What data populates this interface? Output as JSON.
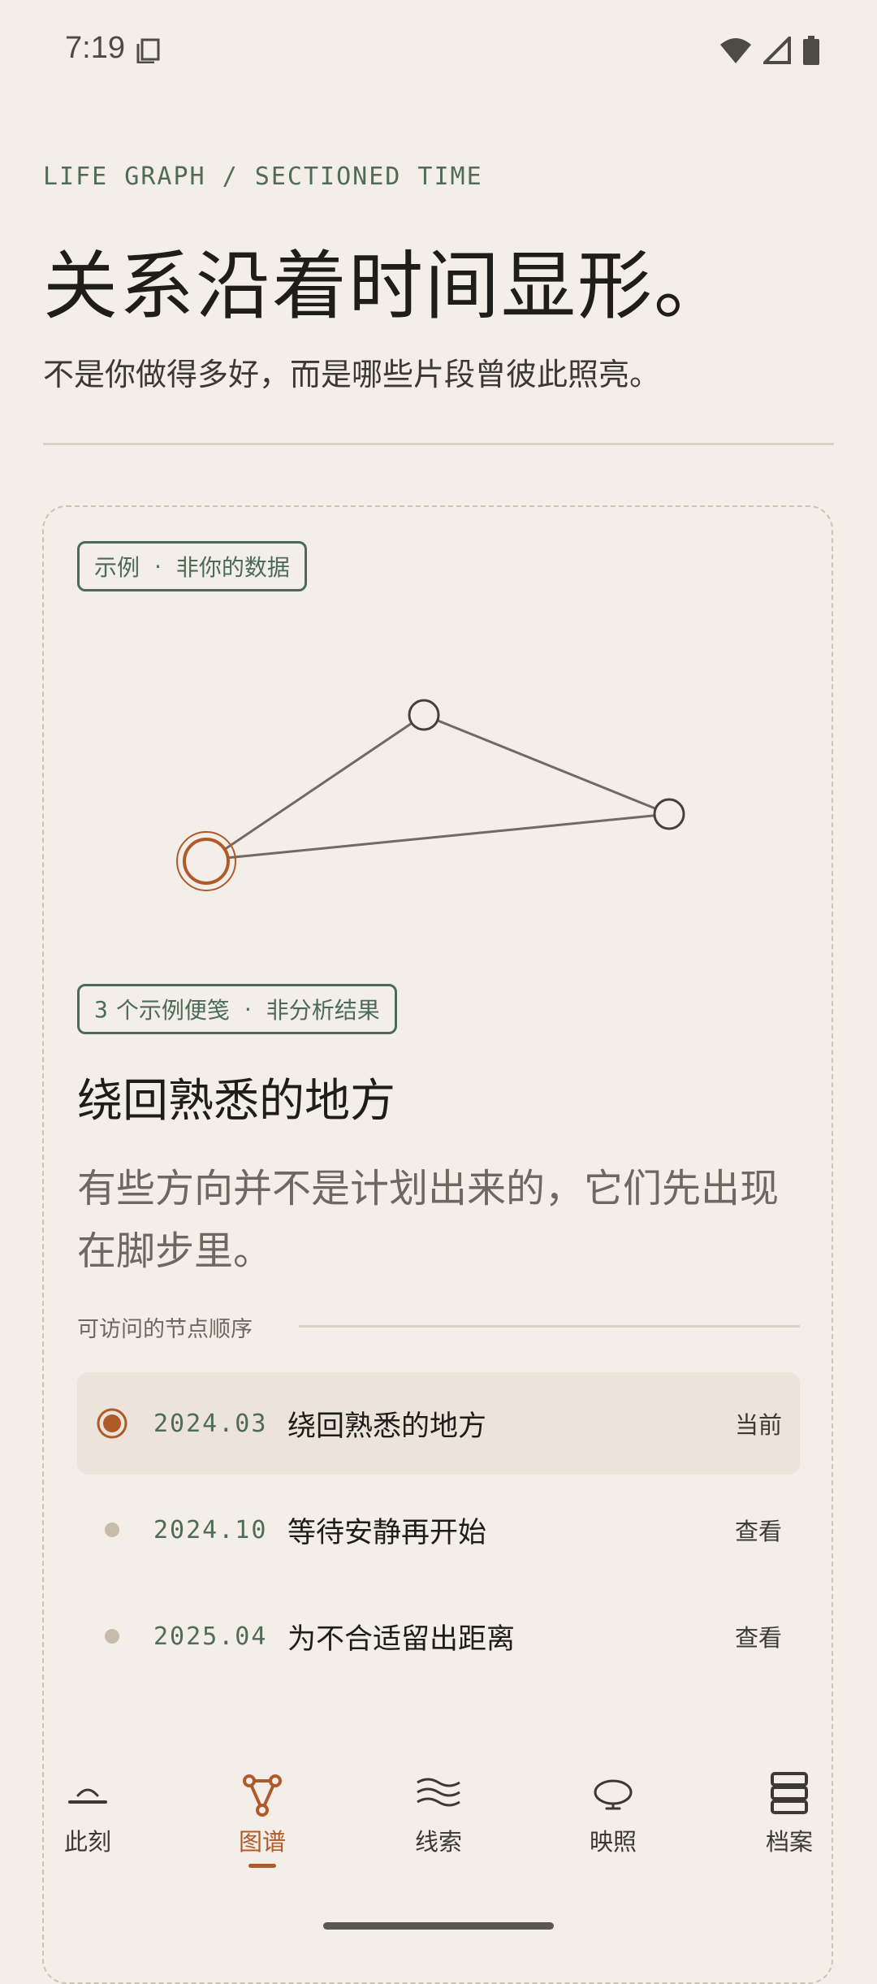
{
  "status": {
    "time": "7:19"
  },
  "header": {
    "kicker": "LIFE GRAPH / SECTIONED TIME",
    "title": "关系沿着时间显形。",
    "subtitle": "不是你做得多好，而是哪些片段曾彼此照亮。"
  },
  "card": {
    "example_tag": {
      "left": "示例",
      "sep": "·",
      "right": "非你的数据"
    },
    "notes_tag": {
      "count": "3",
      "text": "个示例便笺",
      "sep": "·",
      "right": "非分析结果"
    },
    "title": "绕回熟悉的地方",
    "description": "有些方向并不是计划出来的，它们先出现在脚步里。",
    "order_label": "可访问的节点顺序",
    "rows": [
      {
        "date": "2024.03",
        "label": "绕回熟悉的地方",
        "action": "当前",
        "active": true
      },
      {
        "date": "2024.10",
        "label": "等待安静再开始",
        "action": "查看",
        "active": false
      },
      {
        "date": "2025.04",
        "label": "为不合适留出距离",
        "action": "查看",
        "active": false
      }
    ]
  },
  "nav": {
    "items": [
      {
        "label": "此刻",
        "icon": "horizon-icon"
      },
      {
        "label": "图谱",
        "icon": "graph-icon",
        "active": true
      },
      {
        "label": "线索",
        "icon": "waves-icon"
      },
      {
        "label": "映照",
        "icon": "reflection-icon"
      },
      {
        "label": "档案",
        "icon": "archive-icon"
      }
    ]
  },
  "colors": {
    "accent": "#B05A2C",
    "green": "#4B6B58",
    "background": "#F3EEE7"
  }
}
